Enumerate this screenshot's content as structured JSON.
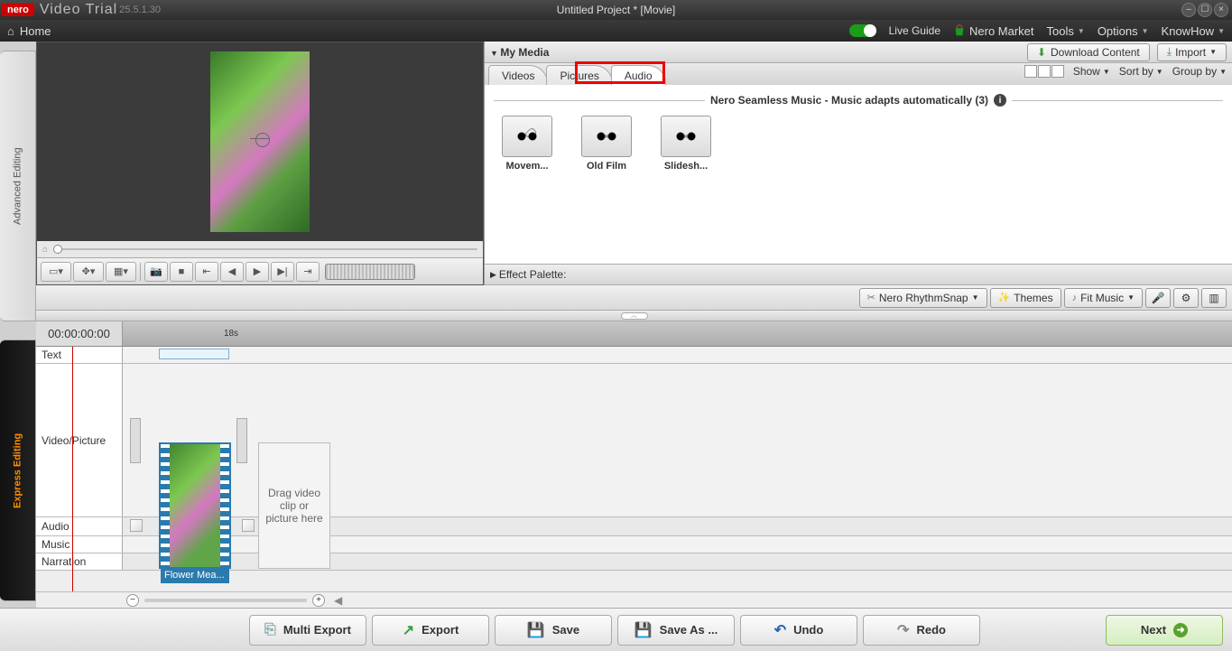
{
  "app": {
    "brand": "nero",
    "name": "Video Trial",
    "version": "25.5.1.30",
    "project_title": "Untitled Project * [Movie]"
  },
  "menubar": {
    "home": "Home",
    "live_guide": "Live Guide",
    "nero_market": "Nero Market",
    "tools": "Tools",
    "options": "Options",
    "knowhow": "KnowHow"
  },
  "sidetabs": {
    "advanced": "Advanced Editing",
    "express": "Express Editing"
  },
  "media": {
    "panel_title": "My Media",
    "download": "Download Content",
    "import": "Import",
    "tabs": {
      "videos": "Videos",
      "pictures": "Pictures",
      "audio": "Audio"
    },
    "view": {
      "show": "Show",
      "sortby": "Sort by",
      "groupby": "Group by"
    },
    "group_heading": "Nero Seamless Music - Music adapts automatically (3)",
    "items": [
      {
        "label": "Movem..."
      },
      {
        "label": "Old Film"
      },
      {
        "label": "Slidesh..."
      }
    ]
  },
  "effect_palette": "Effect Palette:",
  "actionbar": {
    "rhythmsnap": "Nero RhythmSnap",
    "themes": "Themes",
    "fitmusic": "Fit Music"
  },
  "timeline": {
    "current_time": "00:00:00:00",
    "ruler_marker": "18s",
    "rows": {
      "text": "Text",
      "videopicture": "Video/Picture",
      "audio": "Audio",
      "music": "Music",
      "narration": "Narration"
    },
    "clip_name": "Flower Mea...",
    "drop_hint": "Drag video clip or picture here"
  },
  "bottombar": {
    "multiexport": "Multi Export",
    "export": "Export",
    "save": "Save",
    "saveas": "Save As ...",
    "undo": "Undo",
    "redo": "Redo",
    "next": "Next"
  }
}
